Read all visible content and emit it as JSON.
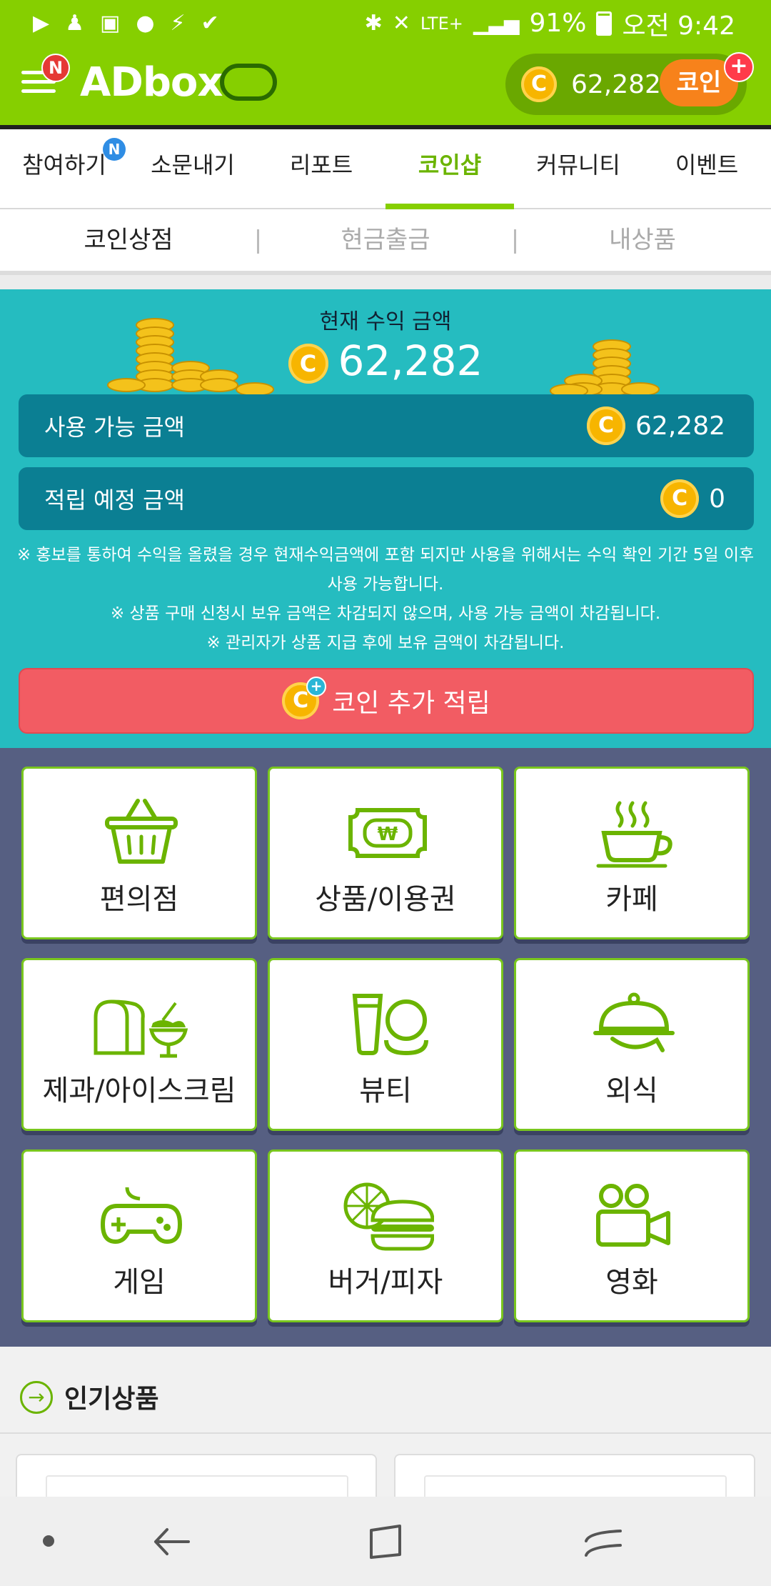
{
  "status_bar": {
    "battery": "91%",
    "time": "오전 9:42",
    "network": "LTE+"
  },
  "app_bar": {
    "logo": "ADbox",
    "menu_badge": "N",
    "coin_balance": "62,282",
    "coin_button": "코인",
    "coin_symbol": "C"
  },
  "tabs": [
    {
      "label": "참여하기",
      "badge": "N"
    },
    {
      "label": "소문내기"
    },
    {
      "label": "리포트"
    },
    {
      "label": "코인샵"
    },
    {
      "label": "커뮤니티"
    },
    {
      "label": "이벤트"
    }
  ],
  "subtabs": [
    "코인상점",
    "현금출금",
    "내상품"
  ],
  "earnings": {
    "title": "현재 수익 금액",
    "total": "62,282",
    "available_label": "사용 가능 금액",
    "available_value": "62,282",
    "pending_label": "적립 예정 금액",
    "pending_value": "0",
    "notice_1": "※ 홍보를 통하여 수익을 올렸을 경우 현재수익금액에 포함 되지만 사용을 위해서는 수익 확인 기간 5일 이후 사용 가능합니다.",
    "notice_2": "※ 상품 구매 신청시 보유 금액은 차감되지 않으며, 사용 가능 금액이 차감됩니다.",
    "notice_3": "※ 관리자가 상품 지급 후에 보유 금액이 차감됩니다.",
    "add_button": "코인 추가 적립"
  },
  "categories": [
    {
      "label": "편의점",
      "icon": "basket-icon"
    },
    {
      "label": "상품/이용권",
      "icon": "ticket-icon"
    },
    {
      "label": "카페",
      "icon": "coffee-icon"
    },
    {
      "label": "제과/아이스크림",
      "icon": "bread-icecream-icon"
    },
    {
      "label": "뷰티",
      "icon": "cosmetics-icon"
    },
    {
      "label": "외식",
      "icon": "dining-icon"
    },
    {
      "label": "게임",
      "icon": "gamepad-icon"
    },
    {
      "label": "버거/피자",
      "icon": "burger-pizza-icon"
    },
    {
      "label": "영화",
      "icon": "camera-icon"
    }
  ],
  "popular": {
    "title": "인기상품"
  },
  "colors": {
    "brand_green": "#86cf00",
    "teal": "#25bcc0",
    "dark_teal": "#0b7f93",
    "red_button": "#f25c63",
    "category_bg": "#565f82"
  }
}
